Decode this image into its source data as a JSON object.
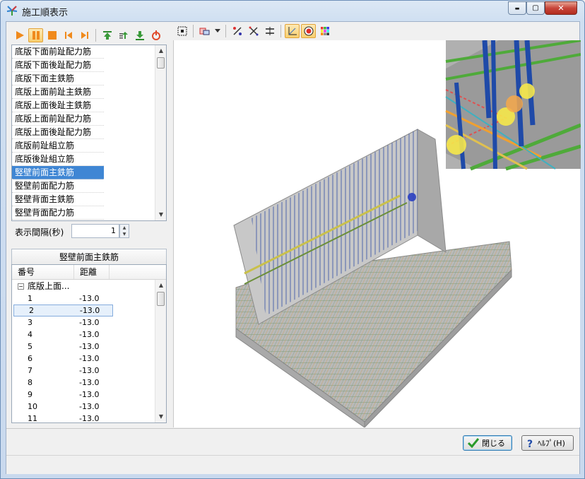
{
  "window": {
    "title": "施工順表示",
    "minimize_glyph": "▬",
    "maximize_glyph": "▢",
    "close_glyph": "✕"
  },
  "left_toolbar": {
    "icons": [
      "play-icon",
      "pause-icon",
      "stop-icon",
      "first-step-icon",
      "last-step-icon",
      "move-top-icon",
      "move-up-icon",
      "move-down-icon",
      "reset-icon"
    ]
  },
  "process_list": {
    "items": [
      "底版下面前趾配力筋",
      "底版下面後趾配力筋",
      "底版下面主鉄筋",
      "底版上面前趾主鉄筋",
      "底版上面後趾主鉄筋",
      "底版上面前趾配力筋",
      "底版上面後趾配力筋",
      "底版前趾組立筋",
      "底版後趾組立筋",
      "竪壁前面主鉄筋",
      "竪壁前面配力筋",
      "竪壁背面主鉄筋",
      "竪壁背面配力筋"
    ],
    "selected_index": 9
  },
  "interval": {
    "label": "表示間隔(秒)",
    "value": "1"
  },
  "detail": {
    "title": "竪壁前面主鉄筋",
    "columns": [
      "番号",
      "距離"
    ],
    "group_label": "底版上面...",
    "expander": "−",
    "rows": [
      {
        "no": "1",
        "dist": "-13.0"
      },
      {
        "no": "2",
        "dist": "-13.0"
      },
      {
        "no": "3",
        "dist": "-13.0"
      },
      {
        "no": "4",
        "dist": "-13.0"
      },
      {
        "no": "5",
        "dist": "-13.0"
      },
      {
        "no": "6",
        "dist": "-13.0"
      },
      {
        "no": "7",
        "dist": "-13.0"
      },
      {
        "no": "8",
        "dist": "-13.0"
      },
      {
        "no": "9",
        "dist": "-13.0"
      },
      {
        "no": "10",
        "dist": "-13.0"
      },
      {
        "no": "11",
        "dist": "-13.0"
      }
    ],
    "selected_row": 1
  },
  "view_toolbar": {
    "icons": [
      "fit-view-icon",
      "view-mode-icon",
      "dropdown-arrow-icon",
      "rebar-select-icon",
      "rebar-cross-icon",
      "align-icon",
      "axis-toggle-icon",
      "target-icon",
      "color-grid-icon"
    ]
  },
  "buttons": {
    "close_label": "閉じる",
    "help_label": "ﾍﾙﾌﾟ(H)"
  },
  "colors": {
    "selection": "#3f86d4",
    "wall_rebar": "#1f3fa0",
    "slab_rebar_green": "#4f8f2a",
    "slab_rebar_orange": "#d88a2a",
    "concrete": "#b9b9b9"
  }
}
